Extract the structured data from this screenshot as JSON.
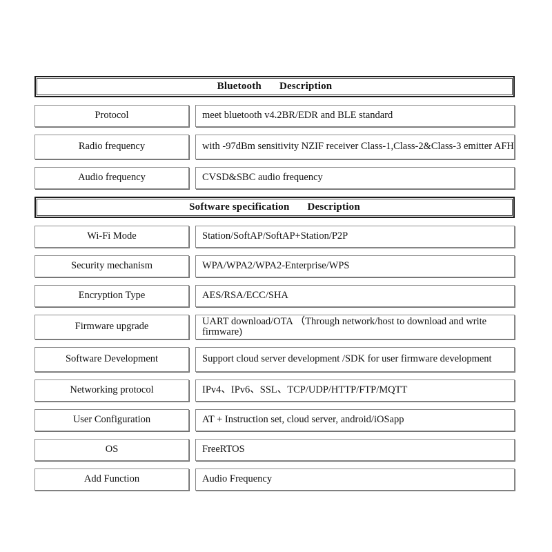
{
  "document": {
    "title": "Bluetooth and Software Specification Table"
  },
  "sections": [
    {
      "id": "bluetooth",
      "header": {
        "title": "Bluetooth",
        "description_label": "Description"
      },
      "rows": [
        {
          "label": "Protocol",
          "value": "meet bluetooth v4.2BR/EDR and BLE standard",
          "wraps": false
        },
        {
          "label": "Radio frequency",
          "value": "with -97dBm sensitivity NZIF receiver Class-1,Class-2&Class-3 emitter AFH",
          "wraps": true
        },
        {
          "label": "Audio frequency",
          "value": "CVSD&SBC audio frequency",
          "wraps": false
        }
      ]
    },
    {
      "id": "software-specification",
      "header": {
        "title": "Software specification",
        "description_label": "Description"
      },
      "rows": [
        {
          "label": "Wi-Fi Mode",
          "value": "Station/SoftAP/SoftAP+Station/P2P",
          "wraps": false
        },
        {
          "label": "Security mechanism",
          "value": "WPA/WPA2/WPA2-Enterprise/WPS",
          "wraps": false
        },
        {
          "label": "Encryption Type",
          "value": "AES/RSA/ECC/SHA",
          "wraps": false
        },
        {
          "label": "Firmware upgrade",
          "value": "UART download/OTA （Through network/host to download and write firmware)",
          "wraps": true
        },
        {
          "label": "Software Development",
          "value": "Support cloud server development /SDK for user firmware development",
          "wraps": true
        },
        {
          "label": "Networking protocol",
          "value": "IPv4、IPv6、SSL、TCP/UDP/HTTP/FTP/MQTT",
          "wraps": false
        },
        {
          "label": "User Configuration",
          "value": "AT + Instruction set, cloud server, android/iOSapp",
          "wraps": false
        },
        {
          "label": "OS",
          "value": "FreeRTOS",
          "wraps": false
        },
        {
          "label": "Add Function",
          "value": "Audio Frequency",
          "wraps": false
        }
      ]
    }
  ],
  "style": {
    "page_background": "#ffffff",
    "text_color": "#111111",
    "header_border_color": "#1a1a1a",
    "cell_border_color": "#8a8a8a"
  }
}
